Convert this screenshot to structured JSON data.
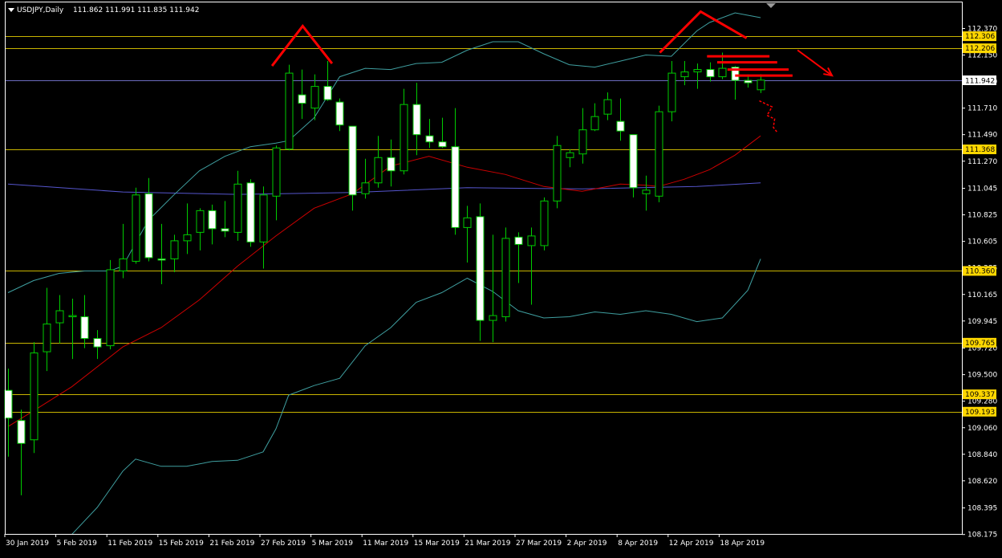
{
  "header": {
    "symbol": "USDJPY,Daily",
    "ohlc": "111.862 111.991 111.835 111.942"
  },
  "colors": {
    "background": "#000000",
    "frame": "#ffffff",
    "bull_body": "#000000",
    "bear_body": "#ffffff",
    "wick": "#00cc00",
    "sma_fast": "#cc0000",
    "sma_slow": "#5555cc",
    "bollinger": "#3f9fa0",
    "level_line": "#c8b400",
    "level_label_bg": "#ffd700",
    "current_line": "#6b6bbd",
    "current_label_bg": "#ffffff",
    "annotation": "#ff0000",
    "axis_text": "#ffffff"
  },
  "chart_data": {
    "type": "candlestick",
    "title": "USDJPY,Daily",
    "ylim": [
      108.175,
      112.475
    ],
    "y_ticks": [
      "112.370",
      "112.150",
      "111.930",
      "111.710",
      "111.490",
      "111.270",
      "111.045",
      "110.825",
      "110.605",
      "110.385",
      "110.165",
      "109.945",
      "109.720",
      "109.500",
      "109.280",
      "109.060",
      "108.840",
      "108.620",
      "108.395",
      "108.175"
    ],
    "x_labels": [
      "30 Jan 2019",
      "5 Feb 2019",
      "11 Feb 2019",
      "15 Feb 2019",
      "21 Feb 2019",
      "27 Feb 2019",
      "5 Mar 2019",
      "11 Mar 2019",
      "15 Mar 2019",
      "21 Mar 2019",
      "27 Mar 2019",
      "2 Apr 2019",
      "8 Apr 2019",
      "12 Apr 2019",
      "18 Apr 2019"
    ],
    "x_label_index": [
      0,
      4,
      8,
      12,
      16,
      20,
      24,
      28,
      32,
      36,
      40,
      44,
      48,
      52,
      56
    ],
    "horizontal_levels": [
      112.306,
      112.206,
      111.368,
      110.36,
      109.765,
      109.337,
      109.193
    ],
    "level_labels": [
      "112.306",
      "112.206",
      "111.368",
      "110.360",
      "109.765",
      "109.337",
      "109.193"
    ],
    "current_price": 111.942,
    "current_price_label": "111.942",
    "candles": [
      {
        "o": 109.37,
        "h": 109.55,
        "l": 108.82,
        "c": 109.14
      },
      {
        "o": 109.12,
        "h": 109.21,
        "l": 108.5,
        "c": 108.93
      },
      {
        "o": 108.96,
        "h": 109.77,
        "l": 108.85,
        "c": 109.68
      },
      {
        "o": 109.69,
        "h": 110.22,
        "l": 109.53,
        "c": 109.92
      },
      {
        "o": 109.93,
        "h": 110.16,
        "l": 109.76,
        "c": 110.03
      },
      {
        "o": 109.98,
        "h": 110.13,
        "l": 109.63,
        "c": 109.99
      },
      {
        "o": 109.98,
        "h": 110.16,
        "l": 109.72,
        "c": 109.8
      },
      {
        "o": 109.8,
        "h": 109.87,
        "l": 109.63,
        "c": 109.73
      },
      {
        "o": 109.74,
        "h": 110.45,
        "l": 109.71,
        "c": 110.37
      },
      {
        "o": 110.36,
        "h": 110.75,
        "l": 110.3,
        "c": 110.46
      },
      {
        "o": 110.44,
        "h": 111.05,
        "l": 110.42,
        "c": 110.99
      },
      {
        "o": 111.0,
        "h": 111.13,
        "l": 110.44,
        "c": 110.47
      },
      {
        "o": 110.46,
        "h": 110.75,
        "l": 110.25,
        "c": 110.45
      },
      {
        "o": 110.46,
        "h": 110.66,
        "l": 110.35,
        "c": 110.61
      },
      {
        "o": 110.61,
        "h": 110.92,
        "l": 110.5,
        "c": 110.66
      },
      {
        "o": 110.68,
        "h": 110.88,
        "l": 110.53,
        "c": 110.86
      },
      {
        "o": 110.86,
        "h": 110.91,
        "l": 110.58,
        "c": 110.71
      },
      {
        "o": 110.71,
        "h": 110.94,
        "l": 110.64,
        "c": 110.69
      },
      {
        "o": 110.68,
        "h": 111.19,
        "l": 110.61,
        "c": 111.08
      },
      {
        "o": 111.09,
        "h": 111.12,
        "l": 110.56,
        "c": 110.6
      },
      {
        "o": 110.6,
        "h": 111.06,
        "l": 110.38,
        "c": 110.99
      },
      {
        "o": 110.98,
        "h": 111.4,
        "l": 110.78,
        "c": 111.38
      },
      {
        "o": 111.37,
        "h": 112.07,
        "l": 111.36,
        "c": 112.0
      },
      {
        "o": 111.82,
        "h": 112.03,
        "l": 111.62,
        "c": 111.75
      },
      {
        "o": 111.71,
        "h": 111.99,
        "l": 111.61,
        "c": 111.89
      },
      {
        "o": 111.89,
        "h": 112.1,
        "l": 111.77,
        "c": 111.78
      },
      {
        "o": 111.76,
        "h": 111.79,
        "l": 111.52,
        "c": 111.57
      },
      {
        "o": 111.56,
        "h": 111.56,
        "l": 110.86,
        "c": 110.99
      },
      {
        "o": 111.0,
        "h": 111.29,
        "l": 110.96,
        "c": 111.09
      },
      {
        "o": 111.09,
        "h": 111.48,
        "l": 111.05,
        "c": 111.3
      },
      {
        "o": 111.3,
        "h": 111.45,
        "l": 111.06,
        "c": 111.19
      },
      {
        "o": 111.19,
        "h": 111.87,
        "l": 111.16,
        "c": 111.74
      },
      {
        "o": 111.74,
        "h": 111.92,
        "l": 111.32,
        "c": 111.49
      },
      {
        "o": 111.48,
        "h": 111.62,
        "l": 111.38,
        "c": 111.43
      },
      {
        "o": 111.43,
        "h": 111.63,
        "l": 111.38,
        "c": 111.39
      },
      {
        "o": 111.39,
        "h": 111.71,
        "l": 110.66,
        "c": 110.72
      },
      {
        "o": 110.72,
        "h": 110.9,
        "l": 110.43,
        "c": 110.8
      },
      {
        "o": 110.81,
        "h": 110.92,
        "l": 109.78,
        "c": 109.95
      },
      {
        "o": 109.95,
        "h": 110.66,
        "l": 109.77,
        "c": 109.99
      },
      {
        "o": 109.98,
        "h": 110.72,
        "l": 109.94,
        "c": 110.63
      },
      {
        "o": 110.64,
        "h": 110.68,
        "l": 110.26,
        "c": 110.58
      },
      {
        "o": 110.57,
        "h": 110.72,
        "l": 110.08,
        "c": 110.65
      },
      {
        "o": 110.57,
        "h": 110.97,
        "l": 110.53,
        "c": 110.94
      },
      {
        "o": 110.94,
        "h": 111.48,
        "l": 110.88,
        "c": 111.4
      },
      {
        "o": 111.3,
        "h": 111.37,
        "l": 111.22,
        "c": 111.34
      },
      {
        "o": 111.33,
        "h": 111.71,
        "l": 111.25,
        "c": 111.53
      },
      {
        "o": 111.53,
        "h": 111.75,
        "l": 111.52,
        "c": 111.64
      },
      {
        "o": 111.66,
        "h": 111.84,
        "l": 111.61,
        "c": 111.78
      },
      {
        "o": 111.6,
        "h": 111.79,
        "l": 111.44,
        "c": 111.52
      },
      {
        "o": 111.49,
        "h": 111.49,
        "l": 110.97,
        "c": 111.05
      },
      {
        "o": 111.0,
        "h": 111.15,
        "l": 110.86,
        "c": 111.03
      },
      {
        "o": 110.98,
        "h": 111.73,
        "l": 110.93,
        "c": 111.68
      },
      {
        "o": 111.68,
        "h": 112.1,
        "l": 111.6,
        "c": 112.0
      },
      {
        "o": 111.97,
        "h": 112.1,
        "l": 111.9,
        "c": 112.01
      },
      {
        "o": 112.01,
        "h": 112.08,
        "l": 111.87,
        "c": 112.03
      },
      {
        "o": 112.03,
        "h": 112.09,
        "l": 111.93,
        "c": 111.97
      },
      {
        "o": 111.97,
        "h": 112.17,
        "l": 111.95,
        "c": 112.04
      },
      {
        "o": 112.05,
        "h": 112.06,
        "l": 111.78,
        "c": 111.94
      },
      {
        "o": 111.94,
        "h": 111.99,
        "l": 111.88,
        "c": 111.92
      },
      {
        "o": 111.862,
        "h": 111.991,
        "l": 111.835,
        "c": 111.942
      }
    ],
    "series": [
      {
        "kind": "sma_slow",
        "x": [
          0,
          9,
          18,
          27,
          36,
          45,
          54,
          59
        ],
        "y": [
          111.08,
          111.015,
          110.995,
          111.01,
          111.05,
          111.04,
          111.06,
          111.09
        ]
      },
      {
        "kind": "sma_fast",
        "x": [
          0,
          2,
          5,
          9,
          12,
          15,
          18,
          21,
          24,
          27,
          30,
          33,
          36,
          39,
          42,
          45,
          48,
          50,
          51,
          53,
          55,
          57,
          59
        ],
        "y": [
          109.07,
          109.2,
          109.4,
          109.73,
          109.89,
          110.12,
          110.4,
          110.65,
          110.88,
          111.0,
          111.23,
          111.31,
          111.22,
          111.16,
          111.06,
          111.02,
          111.08,
          111.07,
          111.06,
          111.12,
          111.2,
          111.32,
          111.48
        ]
      },
      {
        "kind": "bollinger",
        "x": [
          0,
          2,
          4,
          6,
          8,
          9,
          11,
          13,
          15,
          17,
          19,
          21,
          22,
          24,
          26,
          28,
          30,
          32,
          34,
          36,
          38,
          40,
          42,
          44,
          46,
          48,
          50,
          52,
          54,
          55,
          57,
          59
        ],
        "y": [
          110.18,
          110.28,
          110.34,
          110.36,
          110.36,
          110.4,
          110.78,
          110.99,
          111.19,
          111.31,
          111.39,
          111.42,
          111.44,
          111.63,
          111.97,
          112.04,
          112.03,
          112.08,
          112.09,
          112.19,
          112.26,
          112.26,
          112.16,
          112.07,
          112.05,
          112.1,
          112.15,
          112.14,
          112.35,
          112.42,
          112.5,
          112.46
        ]
      },
      {
        "kind": "bollinger",
        "x": [
          5,
          7,
          9,
          10,
          12,
          14,
          16,
          18,
          20,
          21,
          22,
          24,
          26,
          28,
          30,
          32,
          34,
          36,
          38,
          40,
          42,
          44,
          46,
          48,
          50,
          52,
          54,
          56,
          58
        ],
        "y": [
          108.175,
          108.4,
          108.7,
          108.8,
          108.74,
          108.74,
          108.78,
          108.79,
          108.86,
          109.05,
          109.33,
          109.41,
          109.47,
          109.74,
          109.89,
          110.1,
          110.18,
          110.3,
          110.19,
          110.03,
          109.97,
          109.98,
          110.02,
          110.0,
          110.03,
          110.0,
          109.94,
          109.97,
          110.2
        ]
      },
      {
        "kind": "bollinger",
        "x": [
          58,
          59
        ],
        "y": [
          110.2,
          110.46
        ]
      }
    ],
    "annotations": [
      {
        "kind": "line",
        "x": [
          20.7,
          23.1,
          25.4
        ],
        "y": [
          112.06,
          112.39,
          112.08
        ]
      },
      {
        "kind": "line",
        "x": [
          51.1,
          54.3,
          57.9
        ],
        "y": [
          112.17,
          112.51,
          112.29
        ]
      },
      {
        "kind": "line",
        "x": [
          54.8,
          59.7
        ],
        "y": [
          112.14,
          112.14
        ]
      },
      {
        "kind": "line",
        "x": [
          55.6,
          60.3
        ],
        "y": [
          112.09,
          112.09
        ]
      },
      {
        "kind": "line",
        "x": [
          56.4,
          61.2
        ],
        "y": [
          112.03,
          112.03
        ]
      },
      {
        "kind": "line",
        "x": [
          57.0,
          61.5
        ],
        "y": [
          111.98,
          111.98
        ]
      },
      {
        "kind": "arrow",
        "x": [
          61.9,
          64.6
        ],
        "y": [
          112.19,
          111.98
        ]
      },
      {
        "kind": "squiggle",
        "x": [
          58.9,
          59.9,
          59.5,
          60.1,
          60.0,
          60.3
        ],
        "y": [
          111.77,
          111.72,
          111.65,
          111.62,
          111.55,
          111.51
        ]
      }
    ]
  }
}
